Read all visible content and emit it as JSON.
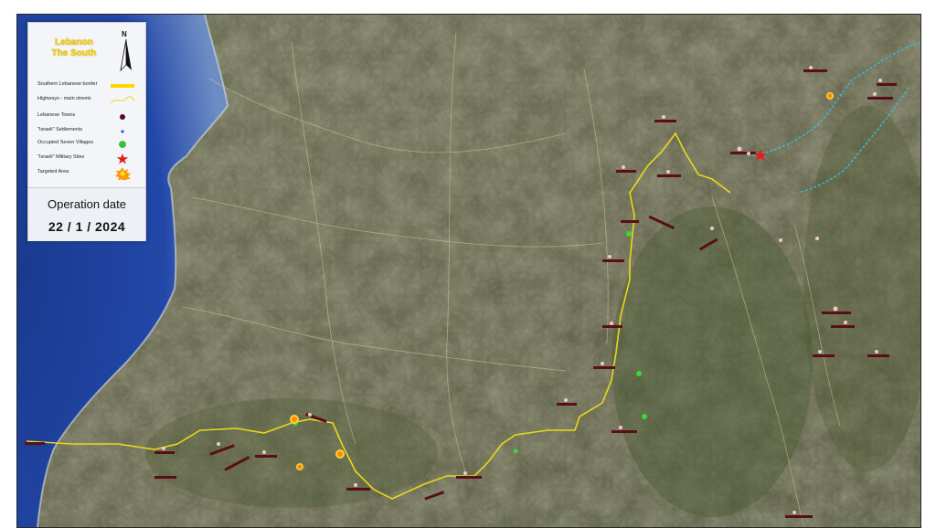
{
  "legend": {
    "title_line1": "Lebanon",
    "title_line2": "The South",
    "north": "N",
    "items": [
      {
        "label": "Southern Lebanese border",
        "icon": "border-line-icon",
        "color": "#ffd400"
      },
      {
        "label": "Highways - main streets",
        "icon": "highway-line-icon",
        "color": "#fff2a0"
      },
      {
        "label": "Lebanese Towns",
        "icon": "town-dot-icon",
        "color": "#5a0e18"
      },
      {
        "label": "\"Israeli\" Settlements",
        "icon": "settlement-dot-icon",
        "color": "#1f5fd6"
      },
      {
        "label": "Occupied Seven Villages",
        "icon": "seven-villages-icon",
        "color": "#2ecc2e"
      },
      {
        "label": "\"Israeli\" Military Sites",
        "icon": "military-star-icon",
        "color": "#e02020"
      },
      {
        "label": "Targeted Area",
        "icon": "explosion-icon",
        "color": "#ff9a00"
      }
    ]
  },
  "operation": {
    "label": "Operation date",
    "date": "22 / 1 / 2024"
  },
  "colors": {
    "sea_deep": "#1b3f9a",
    "sea_shallow": "#6f8ec0",
    "land": "#5d5e45",
    "border_line": "#e8d81c",
    "river": "#3cb8d8",
    "town_marker": "#5a0e18",
    "targeted": "#ff9a00",
    "seven_villages": "#38d838"
  }
}
